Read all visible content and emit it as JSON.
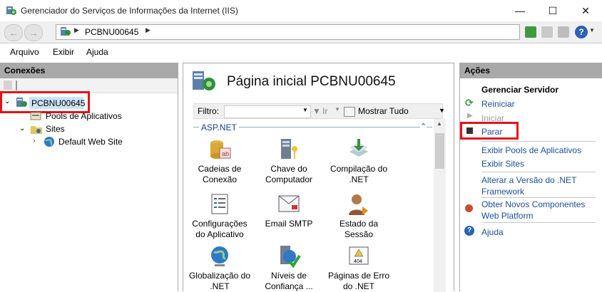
{
  "window": {
    "title": "Gerenciador do Serviços de Informações da Internet (IIS)",
    "minimize": "—",
    "maximize": "☐",
    "close": "✕"
  },
  "address": {
    "back": "←",
    "forward": "→",
    "path": "PCBNU00645",
    "help_glyph": "?"
  },
  "menu": [
    "Arquivo",
    "Exibir",
    "Ajuda"
  ],
  "connections": {
    "header": "Conexões",
    "server": "PCBNU00645",
    "app_pools": "Pools de Aplicativos",
    "sites": "Sites",
    "default_site": "Default Web Site"
  },
  "center": {
    "title": "Página inicial PCBNU00645",
    "filter_label": "Filtro:",
    "go_label": "Ir",
    "show_all": "Mostrar Tudo",
    "group": "ASP.NET",
    "features": [
      {
        "l1": "Cadeias de",
        "l2": "Conexão"
      },
      {
        "l1": "Chave do",
        "l2": "Computador"
      },
      {
        "l1": "Compilação do",
        "l2": ".NET"
      },
      {
        "l1": "Configurações",
        "l2": "do Aplicativo"
      },
      {
        "l1": "Email SMTP",
        "l2": ""
      },
      {
        "l1": "Estado da Sessão",
        "l2": ""
      },
      {
        "l1": "Globalização do",
        "l2": ".NET"
      },
      {
        "l1": "Níveis de",
        "l2": "Confiança ..."
      },
      {
        "l1": "Páginas de Erro",
        "l2": "do .NET"
      }
    ]
  },
  "actions": {
    "header": "Ações",
    "manage": "Gerenciar Servidor",
    "restart": "Reiniciar",
    "start": "Iniciar",
    "stop": "Parar",
    "view_pools": "Exibir Pools de Aplicativos",
    "view_sites": "Exibir Sites",
    "change_net_1": "Alterar a Versão do .NET",
    "change_net_2": "Framework",
    "get_comp_1": "Obter Novos Componentes",
    "get_comp_2": "Web Platform",
    "help": "Ajuda"
  }
}
